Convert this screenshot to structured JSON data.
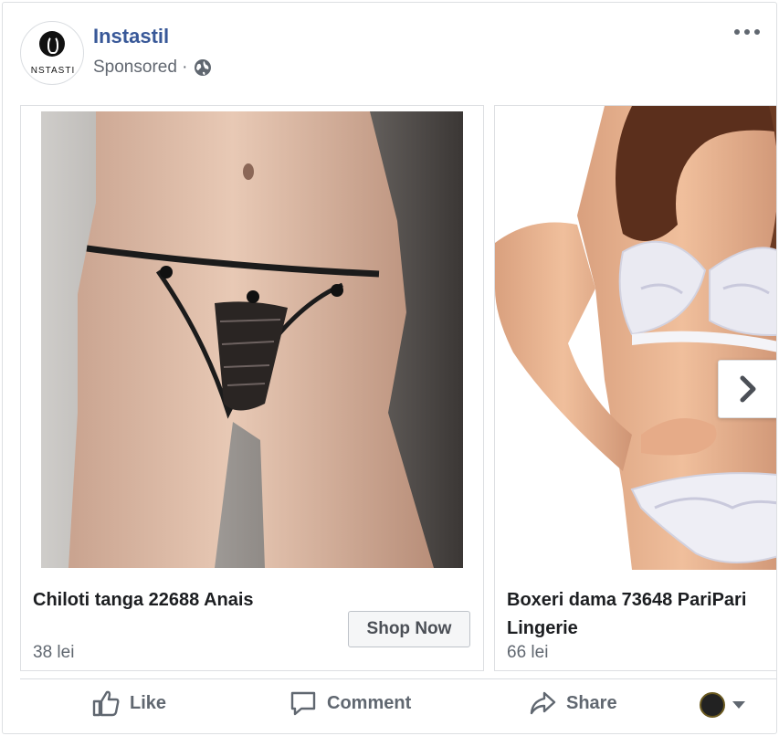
{
  "header": {
    "page_name": "Instastil",
    "avatar_text": "NSTASTI",
    "sponsored": "Sponsored ·",
    "icons": {
      "privacy": "globe-icon",
      "more": "more-options-icon"
    }
  },
  "carousel": {
    "cards": [
      {
        "title": "Chiloti tanga 22688 Anais",
        "price": "38 lei",
        "cta": "Shop Now",
        "image": "lingerie-product-photo"
      },
      {
        "title": "Boxeri dama 73648 PariPari Lingerie",
        "price": "66 lei",
        "image": "lingerie-set-product-photo"
      }
    ],
    "next_icon": "chevron-right-icon"
  },
  "actions": {
    "like": "Like",
    "comment": "Comment",
    "share": "Share",
    "icons": {
      "like": "thumbs-up-icon",
      "comment": "comment-icon",
      "share": "share-icon",
      "profile_caret": "caret-down-icon"
    }
  },
  "colors": {
    "link": "#385898",
    "secondary_text": "#606770",
    "border": "#dddfe2",
    "button_bg": "#f5f6f7"
  }
}
